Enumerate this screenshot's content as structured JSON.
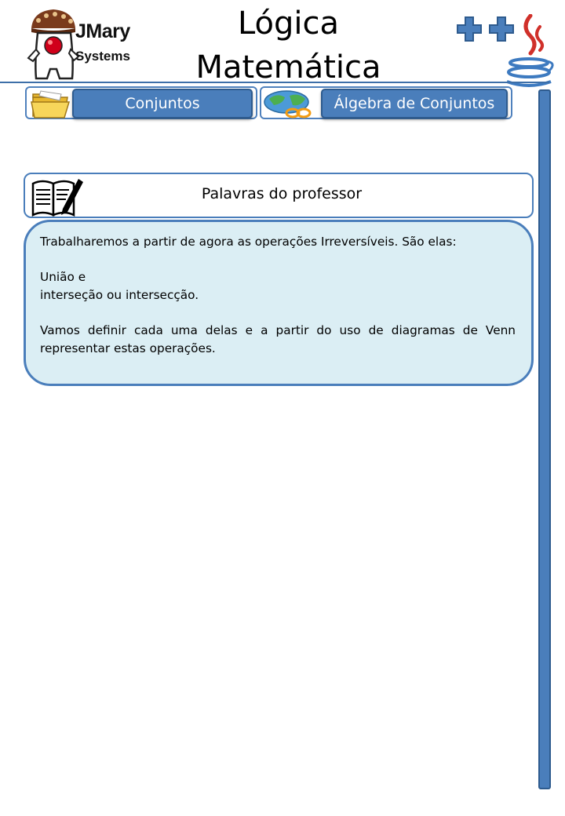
{
  "brand": {
    "name": "JMary",
    "sub": "Systems"
  },
  "title": {
    "line1": "Lógica",
    "line2": "Matemática"
  },
  "icons": {
    "logo": "jmary-mascot-logo",
    "plus": "plus-plus-icon",
    "java": "java-cup-icon",
    "folder": "folder-icon",
    "globe": "globe-icon",
    "book": "open-book-pencil-icon"
  },
  "nav": {
    "tab1": {
      "label": "Conjuntos"
    },
    "tab2": {
      "label": "Álgebra de Conjuntos"
    }
  },
  "section": {
    "title": "Palavras do professor"
  },
  "content": {
    "intro": "Trabalharemos a partir de agora as operações Irreversíveis.  São elas:",
    "item1": "União e",
    "item2": "interseção ou intersecção.",
    "closing": "Vamos definir cada uma delas e a partir do uso de diagramas de Venn representar estas operações."
  },
  "colors": {
    "accent": "#4a7ebb",
    "accent_dark": "#2e5b8e",
    "box_fill": "#dbeef4"
  }
}
